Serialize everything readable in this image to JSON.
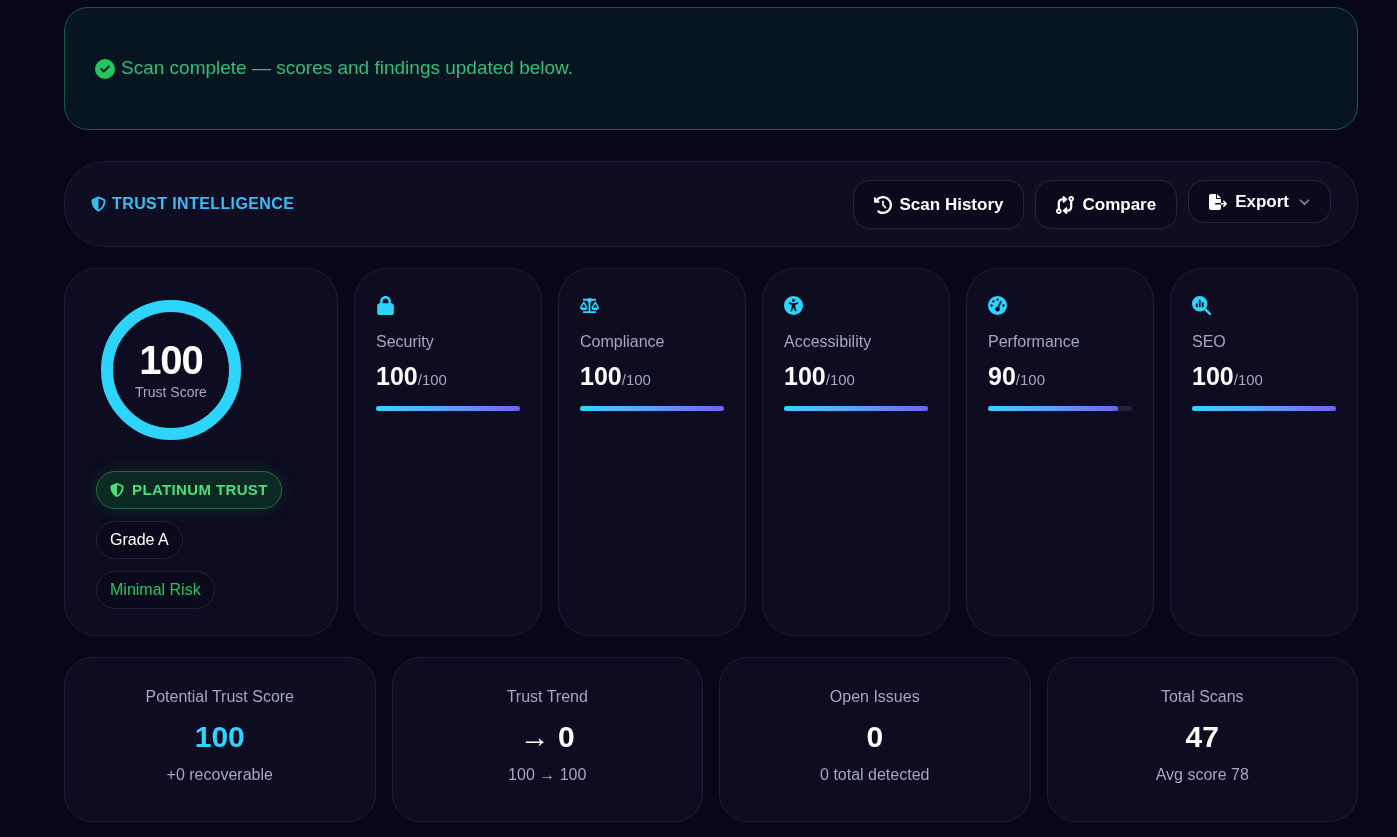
{
  "banner": {
    "text": "Scan complete — scores and findings updated below."
  },
  "header": {
    "title": "TRUST INTELLIGENCE",
    "actions": [
      {
        "label": "Scan History",
        "kind": "history"
      },
      {
        "label": "Compare",
        "kind": "compare"
      },
      {
        "label": "Export",
        "kind": "export"
      }
    ]
  },
  "trust_score": {
    "value": "100",
    "label": "Trust Score",
    "level": 1,
    "badges": [
      {
        "label": "PLATINUM TRUST",
        "kind": "tier"
      },
      {
        "label": "Grade A",
        "kind": "grade"
      },
      {
        "label": "Minimal Risk",
        "kind": "risk"
      }
    ]
  },
  "categories": [
    {
      "name": "Security",
      "kind": "security",
      "score": "100",
      "max": "/100",
      "level": 1
    },
    {
      "name": "Compliance",
      "kind": "compliance",
      "score": "100",
      "max": "/100",
      "level": 1
    },
    {
      "name": "Accessibility",
      "kind": "accessibility",
      "score": "100",
      "max": "/100",
      "level": 1
    },
    {
      "name": "Performance",
      "kind": "performance",
      "score": "90",
      "max": "/100",
      "level": 0.9
    },
    {
      "name": "SEO",
      "kind": "seo",
      "score": "100",
      "max": "/100",
      "level": 1
    }
  ],
  "stats": [
    {
      "label": "Potential Trust Score",
      "value": "100",
      "note": "+0 recoverable",
      "kind": "accent"
    },
    {
      "label": "Trust Trend",
      "value": "→ 0",
      "note": "100 → 100",
      "kind": "plain"
    },
    {
      "label": "Open Issues",
      "value": "0",
      "note": "0 total detected",
      "kind": "plain"
    },
    {
      "label": "Total Scans",
      "value": "47",
      "note": "Avg score 78",
      "kind": "plain"
    }
  ]
}
